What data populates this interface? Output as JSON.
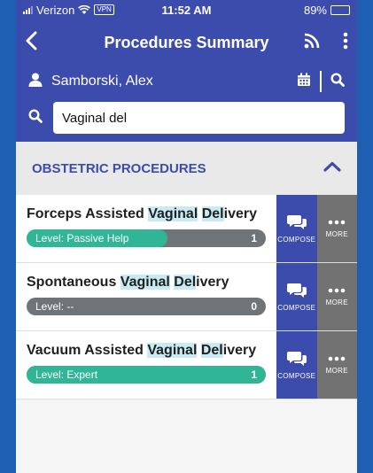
{
  "status_bar": {
    "carrier": "Verizon",
    "vpn": "VPN",
    "time": "11:52 AM",
    "battery": "89%"
  },
  "nav": {
    "title": "Procedures Summary",
    "icons": [
      "back-icon",
      "rss-icon",
      "more-vertical-icon"
    ]
  },
  "user": {
    "name": "Samborski, Alex",
    "icons": [
      "person-icon",
      "calendar-icon",
      "search-icon"
    ]
  },
  "search": {
    "value": "Vaginal del",
    "placeholder": ""
  },
  "section": {
    "title": "OBSTETRIC PROCEDURES",
    "expanded": true
  },
  "procedures": [
    {
      "name_before": "Forceps Assisted ",
      "match1": "Vaginal",
      "between": " ",
      "match2": "Del",
      "name_after": "ivery",
      "level_label": "Level: Passive Help",
      "count": "1",
      "level_fraction": 0.59
    },
    {
      "name_before": "Spontaneous ",
      "match1": "Vaginal",
      "between": " ",
      "match2": "Del",
      "name_after": "ivery",
      "level_label": "Level: --",
      "count": "0",
      "level_fraction": 0.0
    },
    {
      "name_before": "Vacuum Assisted ",
      "match1": "Vaginal",
      "between": " ",
      "match2": "Del",
      "name_after": "ivery",
      "level_label": "Level: Expert",
      "count": "1",
      "level_fraction": 1.0
    }
  ],
  "actions": {
    "compose_label": "COMPOSE",
    "more_label": "MORE"
  },
  "colors": {
    "primary": "#3c4cad",
    "level_fill": "#30b596",
    "level_track": "#6f7478",
    "highlight": "#c8eaf3",
    "more_bg": "#727272"
  }
}
